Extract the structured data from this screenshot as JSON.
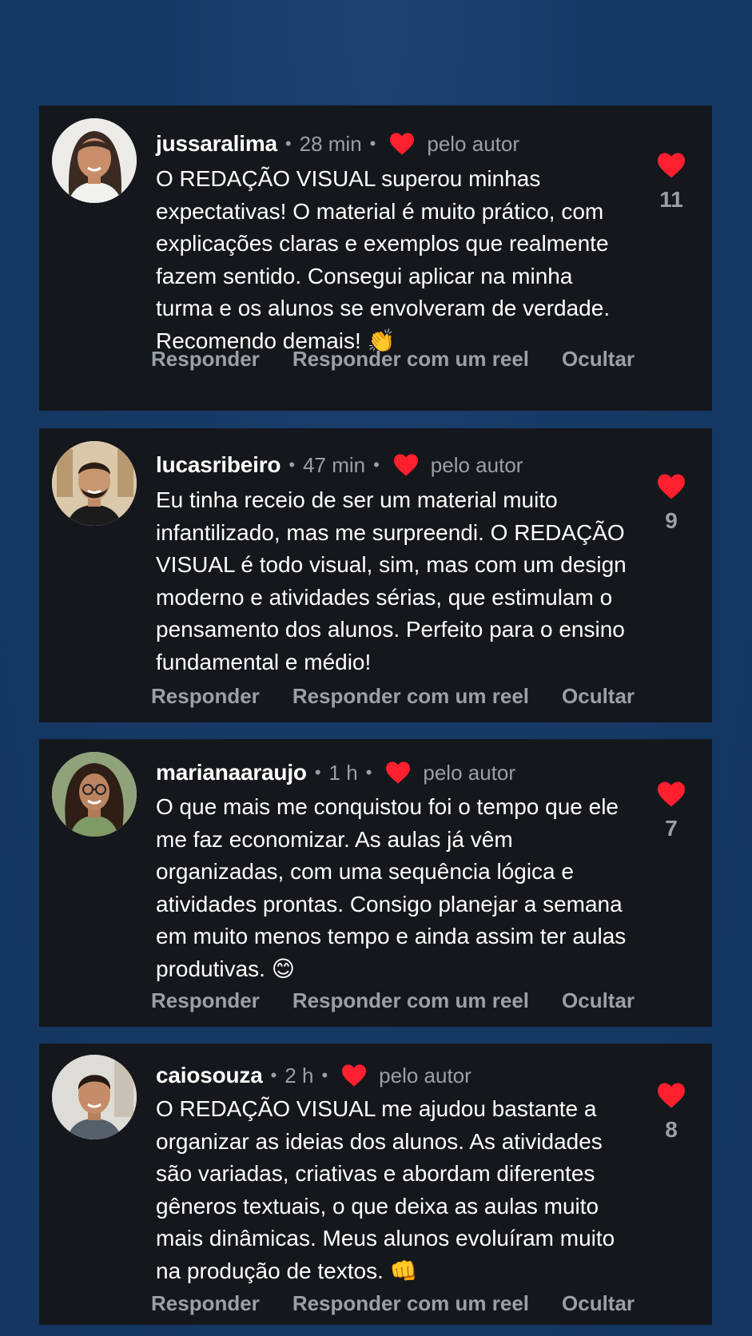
{
  "comments": [
    {
      "username": "jussaralima",
      "time": "28 min",
      "author_label": "pelo autor",
      "text": "O REDAÇÃO VISUAL superou minhas expectativas! O material é muito prático, com explicações claras e exemplos que realmente fazem sentido. Consegui aplicar na minha turma e os alunos se envolveram de verdade. Recomendo demais! 👏",
      "likes": "11",
      "actions": [
        "Responder",
        "Responder com um reel",
        "Ocultar"
      ]
    },
    {
      "username": "lucasribeiro",
      "time": "47 min",
      "author_label": "pelo autor",
      "text": "Eu tinha receio de ser um material muito infantilizado, mas me surpreendi. O REDAÇÃO VISUAL é todo visual, sim, mas com um design moderno e atividades sérias, que estimulam o pensamento dos alunos. Perfeito para o ensino fundamental e médio!",
      "likes": "9",
      "actions": [
        "Responder",
        "Responder com um reel",
        "Ocultar"
      ]
    },
    {
      "username": "marianaaraujo",
      "time": "1 h",
      "author_label": "pelo autor",
      "text": "O que mais me conquistou foi o tempo que ele me faz economizar. As aulas já vêm organizadas, com uma sequência lógica e atividades prontas. Consigo planejar a semana em muito menos tempo e ainda assim ter aulas produtivas. 😊",
      "likes": "7",
      "actions": [
        "Responder",
        "Responder com um reel",
        "Ocultar"
      ]
    },
    {
      "username": "caiosouza",
      "time": "2 h",
      "author_label": "pelo autor",
      "text": "O REDAÇÃO VISUAL me ajudou bastante a organizar as ideias dos alunos. As atividades são variadas, criativas e abordam diferentes gêneros textuais, o que deixa as aulas muito mais dinâmicas. Meus alunos evoluíram muito na produção de textos. 👊",
      "likes": "8",
      "actions": [
        "Responder",
        "Responder com um reel",
        "Ocultar"
      ]
    }
  ],
  "colors": {
    "background": "#163a66",
    "card": "#14171c",
    "heart": "#ff1f2e",
    "muted": "#9aa0a7"
  },
  "icons": {
    "author_like": "heart-icon",
    "like": "heart-icon",
    "avatar": "profile-photo"
  }
}
